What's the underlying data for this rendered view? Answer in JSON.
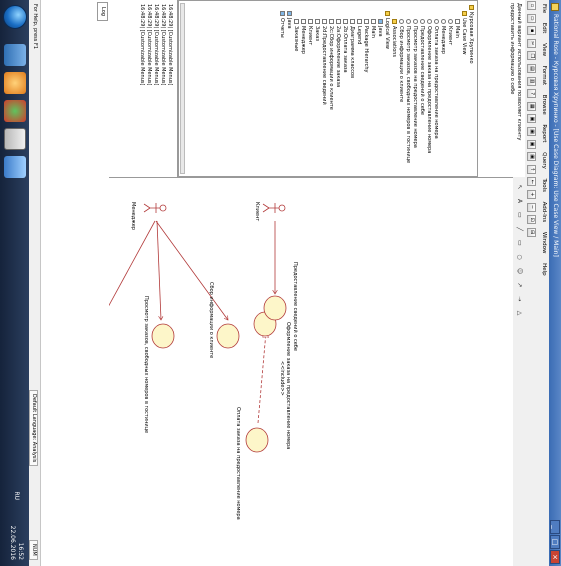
{
  "window": {
    "title": "Rational Rose - Курсовая Хрупинко - [Use Case Diagram: Use Case View / Main]",
    "caption_buttons": [
      "_",
      "□",
      "×"
    ]
  },
  "menu": [
    "File",
    "Edit",
    "View",
    "Format",
    "Browse",
    "Report",
    "Query",
    "Tools",
    "Add-Ins",
    "Window",
    "Help"
  ],
  "document_text": "Данный вариант использования позволяет клиенту предоставить информацию о себе",
  "browser_tree": [
    {
      "label": "Курсовая Хрупинко",
      "icon": "folder-icon"
    },
    {
      "label": "Use Case View",
      "icon": "folder-icon"
    },
    {
      "label": "Main",
      "icon": "diagram-icon"
    },
    {
      "label": "Клиент",
      "icon": "actor-icon"
    },
    {
      "label": "Менеджер",
      "icon": "actor-icon"
    },
    {
      "label": "Оплата заказа на предоставление номера",
      "icon": "use-case-icon"
    },
    {
      "label": "Оформление заказа на предоставление номера",
      "icon": "use-case-icon"
    },
    {
      "label": "Предоставление сведений о себе",
      "icon": "use-case-icon"
    },
    {
      "label": "Просмотр заказов на предоставление номера",
      "icon": "use-case-icon"
    },
    {
      "label": "Просмотр заказов, свободных номеров в гостинице",
      "icon": "use-case-icon"
    },
    {
      "label": "Сбор информации о клиенте",
      "icon": "use-case-icon"
    },
    {
      "label": "Associations",
      "icon": "folder-icon"
    },
    {
      "label": "Logical View",
      "icon": "folder-icon"
    },
    {
      "label": "Java",
      "icon": "package-icon"
    },
    {
      "label": "Main",
      "icon": "diagram-icon"
    },
    {
      "label": "Package Hierarchy",
      "icon": "diagram-icon"
    },
    {
      "label": "Legend",
      "icon": "diagram-icon"
    },
    {
      "label": "Диаграмма классов",
      "icon": "diagram-icon"
    },
    {
      "label": "2b:Оплата заказа",
      "icon": "diagram-icon"
    },
    {
      "label": "2a:Оформление заказа",
      "icon": "diagram-icon"
    },
    {
      "label": "2c:Сбор информации о клиенте",
      "icon": "diagram-icon"
    },
    {
      "label": "2d:Предоставление сведений",
      "icon": "diagram-icon"
    },
    {
      "label": "Заказ",
      "icon": "class-icon"
    },
    {
      "label": "Клиент",
      "icon": "class-icon"
    },
    {
      "label": "Менеджер",
      "icon": "class-icon"
    },
    {
      "label": "Заказные",
      "icon": "class-icon"
    },
    {
      "label": "Java",
      "icon": "package-icon"
    },
    {
      "label": "Отчеты",
      "icon": "package-icon"
    }
  ],
  "log": {
    "rows": [
      "16:48:29| [Customizable Menus]",
      "16:48:29| [Customizable Menus]",
      "16:48:29| [Customizable Menus]",
      "16:48:29| [Customizable Menus]",
      "16:48:29| [Customizable Menus]"
    ],
    "tab_label": "Log"
  },
  "diagram": {
    "actors": [
      {
        "name": "Менеджер"
      },
      {
        "name": "Клиент"
      }
    ],
    "use_cases": [
      {
        "name": "Сбор информации о клиенте"
      },
      {
        "name": "Просмотр заказов, свободных номеров в гостинице"
      },
      {
        "name": "Оформление заказа на предоставление номера"
      },
      {
        "name": "Оплата заказа на предоставление номера"
      },
      {
        "name": "Предоставление сведений о себе"
      }
    ],
    "relation_label": "<<include>>"
  },
  "status": {
    "help_hint": "For Help, press F1",
    "language": "Default Language: Analysis",
    "mode": "NUM"
  },
  "taskbar": {
    "lang": "RU",
    "time": "16:52",
    "date": "22.06.2016"
  },
  "colors": {
    "title_bar": "#3a6cb4",
    "use_case_fill": "#fdf6c9",
    "use_case_stroke": "#b23a3a",
    "association_line": "#b23a3a",
    "taskbar": "#1d2d49"
  }
}
